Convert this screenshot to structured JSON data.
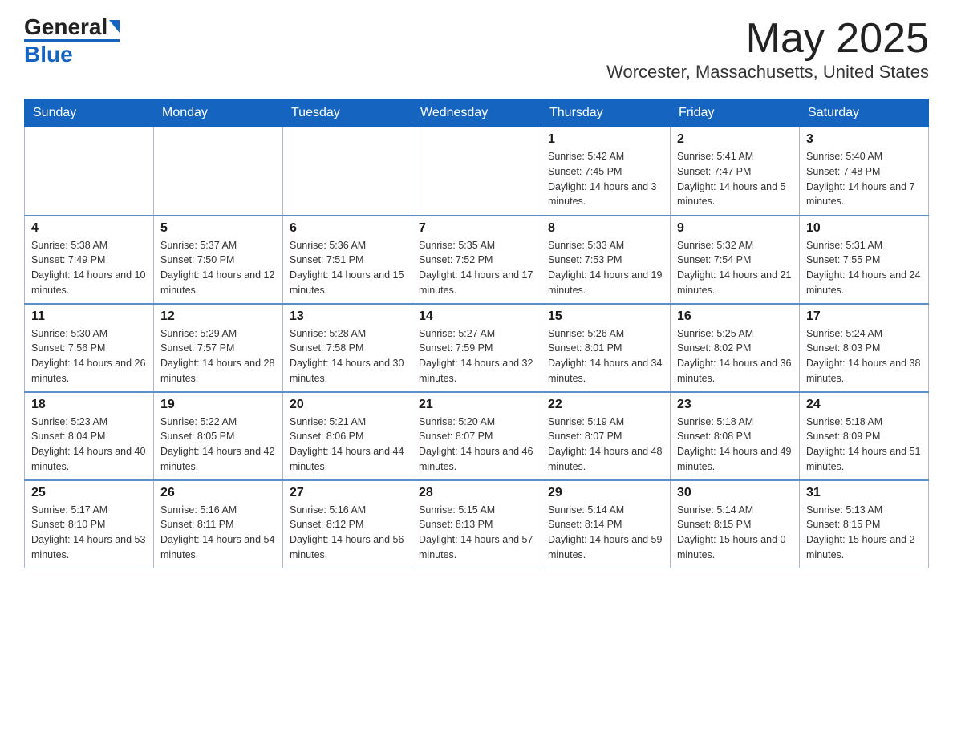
{
  "header": {
    "logo_general": "General",
    "logo_blue": "Blue",
    "month_title": "May 2025",
    "location": "Worcester, Massachusetts, United States"
  },
  "days_of_week": [
    "Sunday",
    "Monday",
    "Tuesday",
    "Wednesday",
    "Thursday",
    "Friday",
    "Saturday"
  ],
  "weeks": [
    [
      {
        "day": "",
        "sunrise": "",
        "sunset": "",
        "daylight": ""
      },
      {
        "day": "",
        "sunrise": "",
        "sunset": "",
        "daylight": ""
      },
      {
        "day": "",
        "sunrise": "",
        "sunset": "",
        "daylight": ""
      },
      {
        "day": "",
        "sunrise": "",
        "sunset": "",
        "daylight": ""
      },
      {
        "day": "1",
        "sunrise": "Sunrise: 5:42 AM",
        "sunset": "Sunset: 7:45 PM",
        "daylight": "Daylight: 14 hours and 3 minutes."
      },
      {
        "day": "2",
        "sunrise": "Sunrise: 5:41 AM",
        "sunset": "Sunset: 7:47 PM",
        "daylight": "Daylight: 14 hours and 5 minutes."
      },
      {
        "day": "3",
        "sunrise": "Sunrise: 5:40 AM",
        "sunset": "Sunset: 7:48 PM",
        "daylight": "Daylight: 14 hours and 7 minutes."
      }
    ],
    [
      {
        "day": "4",
        "sunrise": "Sunrise: 5:38 AM",
        "sunset": "Sunset: 7:49 PM",
        "daylight": "Daylight: 14 hours and 10 minutes."
      },
      {
        "day": "5",
        "sunrise": "Sunrise: 5:37 AM",
        "sunset": "Sunset: 7:50 PM",
        "daylight": "Daylight: 14 hours and 12 minutes."
      },
      {
        "day": "6",
        "sunrise": "Sunrise: 5:36 AM",
        "sunset": "Sunset: 7:51 PM",
        "daylight": "Daylight: 14 hours and 15 minutes."
      },
      {
        "day": "7",
        "sunrise": "Sunrise: 5:35 AM",
        "sunset": "Sunset: 7:52 PM",
        "daylight": "Daylight: 14 hours and 17 minutes."
      },
      {
        "day": "8",
        "sunrise": "Sunrise: 5:33 AM",
        "sunset": "Sunset: 7:53 PM",
        "daylight": "Daylight: 14 hours and 19 minutes."
      },
      {
        "day": "9",
        "sunrise": "Sunrise: 5:32 AM",
        "sunset": "Sunset: 7:54 PM",
        "daylight": "Daylight: 14 hours and 21 minutes."
      },
      {
        "day": "10",
        "sunrise": "Sunrise: 5:31 AM",
        "sunset": "Sunset: 7:55 PM",
        "daylight": "Daylight: 14 hours and 24 minutes."
      }
    ],
    [
      {
        "day": "11",
        "sunrise": "Sunrise: 5:30 AM",
        "sunset": "Sunset: 7:56 PM",
        "daylight": "Daylight: 14 hours and 26 minutes."
      },
      {
        "day": "12",
        "sunrise": "Sunrise: 5:29 AM",
        "sunset": "Sunset: 7:57 PM",
        "daylight": "Daylight: 14 hours and 28 minutes."
      },
      {
        "day": "13",
        "sunrise": "Sunrise: 5:28 AM",
        "sunset": "Sunset: 7:58 PM",
        "daylight": "Daylight: 14 hours and 30 minutes."
      },
      {
        "day": "14",
        "sunrise": "Sunrise: 5:27 AM",
        "sunset": "Sunset: 7:59 PM",
        "daylight": "Daylight: 14 hours and 32 minutes."
      },
      {
        "day": "15",
        "sunrise": "Sunrise: 5:26 AM",
        "sunset": "Sunset: 8:01 PM",
        "daylight": "Daylight: 14 hours and 34 minutes."
      },
      {
        "day": "16",
        "sunrise": "Sunrise: 5:25 AM",
        "sunset": "Sunset: 8:02 PM",
        "daylight": "Daylight: 14 hours and 36 minutes."
      },
      {
        "day": "17",
        "sunrise": "Sunrise: 5:24 AM",
        "sunset": "Sunset: 8:03 PM",
        "daylight": "Daylight: 14 hours and 38 minutes."
      }
    ],
    [
      {
        "day": "18",
        "sunrise": "Sunrise: 5:23 AM",
        "sunset": "Sunset: 8:04 PM",
        "daylight": "Daylight: 14 hours and 40 minutes."
      },
      {
        "day": "19",
        "sunrise": "Sunrise: 5:22 AM",
        "sunset": "Sunset: 8:05 PM",
        "daylight": "Daylight: 14 hours and 42 minutes."
      },
      {
        "day": "20",
        "sunrise": "Sunrise: 5:21 AM",
        "sunset": "Sunset: 8:06 PM",
        "daylight": "Daylight: 14 hours and 44 minutes."
      },
      {
        "day": "21",
        "sunrise": "Sunrise: 5:20 AM",
        "sunset": "Sunset: 8:07 PM",
        "daylight": "Daylight: 14 hours and 46 minutes."
      },
      {
        "day": "22",
        "sunrise": "Sunrise: 5:19 AM",
        "sunset": "Sunset: 8:07 PM",
        "daylight": "Daylight: 14 hours and 48 minutes."
      },
      {
        "day": "23",
        "sunrise": "Sunrise: 5:18 AM",
        "sunset": "Sunset: 8:08 PM",
        "daylight": "Daylight: 14 hours and 49 minutes."
      },
      {
        "day": "24",
        "sunrise": "Sunrise: 5:18 AM",
        "sunset": "Sunset: 8:09 PM",
        "daylight": "Daylight: 14 hours and 51 minutes."
      }
    ],
    [
      {
        "day": "25",
        "sunrise": "Sunrise: 5:17 AM",
        "sunset": "Sunset: 8:10 PM",
        "daylight": "Daylight: 14 hours and 53 minutes."
      },
      {
        "day": "26",
        "sunrise": "Sunrise: 5:16 AM",
        "sunset": "Sunset: 8:11 PM",
        "daylight": "Daylight: 14 hours and 54 minutes."
      },
      {
        "day": "27",
        "sunrise": "Sunrise: 5:16 AM",
        "sunset": "Sunset: 8:12 PM",
        "daylight": "Daylight: 14 hours and 56 minutes."
      },
      {
        "day": "28",
        "sunrise": "Sunrise: 5:15 AM",
        "sunset": "Sunset: 8:13 PM",
        "daylight": "Daylight: 14 hours and 57 minutes."
      },
      {
        "day": "29",
        "sunrise": "Sunrise: 5:14 AM",
        "sunset": "Sunset: 8:14 PM",
        "daylight": "Daylight: 14 hours and 59 minutes."
      },
      {
        "day": "30",
        "sunrise": "Sunrise: 5:14 AM",
        "sunset": "Sunset: 8:15 PM",
        "daylight": "Daylight: 15 hours and 0 minutes."
      },
      {
        "day": "31",
        "sunrise": "Sunrise: 5:13 AM",
        "sunset": "Sunset: 8:15 PM",
        "daylight": "Daylight: 15 hours and 2 minutes."
      }
    ]
  ]
}
